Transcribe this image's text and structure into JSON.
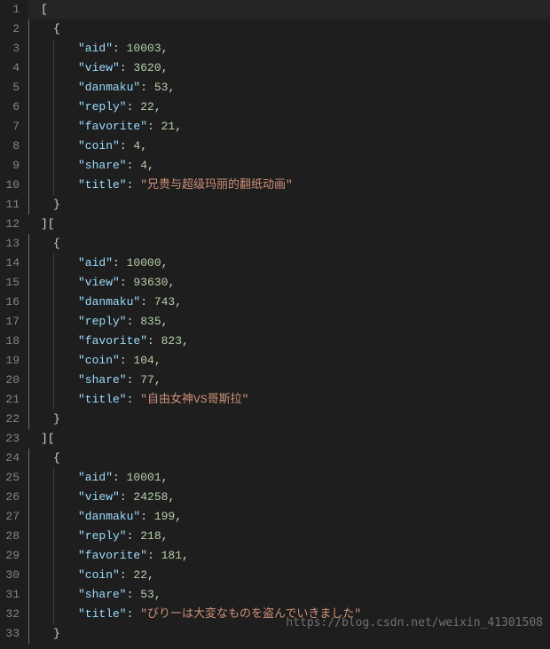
{
  "lines": [
    {
      "n": 1,
      "ind": 0,
      "tokens": [
        {
          "t": "bracket",
          "v": "["
        }
      ],
      "hl": true
    },
    {
      "n": 2,
      "ind": 1,
      "tokens": [
        {
          "t": "bracket",
          "v": "{"
        }
      ]
    },
    {
      "n": 3,
      "ind": 2,
      "tokens": [
        {
          "t": "key",
          "v": "\"aid\""
        },
        {
          "t": "colon",
          "v": ": "
        },
        {
          "t": "num",
          "v": "10003"
        },
        {
          "t": "comma",
          "v": ","
        }
      ]
    },
    {
      "n": 4,
      "ind": 2,
      "tokens": [
        {
          "t": "key",
          "v": "\"view\""
        },
        {
          "t": "colon",
          "v": ": "
        },
        {
          "t": "num",
          "v": "3620"
        },
        {
          "t": "comma",
          "v": ","
        }
      ]
    },
    {
      "n": 5,
      "ind": 2,
      "tokens": [
        {
          "t": "key",
          "v": "\"danmaku\""
        },
        {
          "t": "colon",
          "v": ": "
        },
        {
          "t": "num",
          "v": "53"
        },
        {
          "t": "comma",
          "v": ","
        }
      ]
    },
    {
      "n": 6,
      "ind": 2,
      "tokens": [
        {
          "t": "key",
          "v": "\"reply\""
        },
        {
          "t": "colon",
          "v": ": "
        },
        {
          "t": "num",
          "v": "22"
        },
        {
          "t": "comma",
          "v": ","
        }
      ]
    },
    {
      "n": 7,
      "ind": 2,
      "tokens": [
        {
          "t": "key",
          "v": "\"favorite\""
        },
        {
          "t": "colon",
          "v": ": "
        },
        {
          "t": "num",
          "v": "21"
        },
        {
          "t": "comma",
          "v": ","
        }
      ]
    },
    {
      "n": 8,
      "ind": 2,
      "tokens": [
        {
          "t": "key",
          "v": "\"coin\""
        },
        {
          "t": "colon",
          "v": ": "
        },
        {
          "t": "num",
          "v": "4"
        },
        {
          "t": "comma",
          "v": ","
        }
      ]
    },
    {
      "n": 9,
      "ind": 2,
      "tokens": [
        {
          "t": "key",
          "v": "\"share\""
        },
        {
          "t": "colon",
          "v": ": "
        },
        {
          "t": "num",
          "v": "4"
        },
        {
          "t": "comma",
          "v": ","
        }
      ]
    },
    {
      "n": 10,
      "ind": 2,
      "tokens": [
        {
          "t": "key",
          "v": "\"title\""
        },
        {
          "t": "colon",
          "v": ": "
        },
        {
          "t": "str",
          "v": "\"兄贵与超级玛丽的翻纸动画\""
        }
      ]
    },
    {
      "n": 11,
      "ind": 1,
      "tokens": [
        {
          "t": "bracket",
          "v": "}"
        }
      ]
    },
    {
      "n": 12,
      "ind": 0,
      "tokens": [
        {
          "t": "bracket",
          "v": "]["
        }
      ]
    },
    {
      "n": 13,
      "ind": 1,
      "tokens": [
        {
          "t": "bracket",
          "v": "{"
        }
      ]
    },
    {
      "n": 14,
      "ind": 2,
      "tokens": [
        {
          "t": "key",
          "v": "\"aid\""
        },
        {
          "t": "colon",
          "v": ": "
        },
        {
          "t": "num",
          "v": "10000"
        },
        {
          "t": "comma",
          "v": ","
        }
      ]
    },
    {
      "n": 15,
      "ind": 2,
      "tokens": [
        {
          "t": "key",
          "v": "\"view\""
        },
        {
          "t": "colon",
          "v": ": "
        },
        {
          "t": "num",
          "v": "93630"
        },
        {
          "t": "comma",
          "v": ","
        }
      ]
    },
    {
      "n": 16,
      "ind": 2,
      "tokens": [
        {
          "t": "key",
          "v": "\"danmaku\""
        },
        {
          "t": "colon",
          "v": ": "
        },
        {
          "t": "num",
          "v": "743"
        },
        {
          "t": "comma",
          "v": ","
        }
      ]
    },
    {
      "n": 17,
      "ind": 2,
      "tokens": [
        {
          "t": "key",
          "v": "\"reply\""
        },
        {
          "t": "colon",
          "v": ": "
        },
        {
          "t": "num",
          "v": "835"
        },
        {
          "t": "comma",
          "v": ","
        }
      ]
    },
    {
      "n": 18,
      "ind": 2,
      "tokens": [
        {
          "t": "key",
          "v": "\"favorite\""
        },
        {
          "t": "colon",
          "v": ": "
        },
        {
          "t": "num",
          "v": "823"
        },
        {
          "t": "comma",
          "v": ","
        }
      ]
    },
    {
      "n": 19,
      "ind": 2,
      "tokens": [
        {
          "t": "key",
          "v": "\"coin\""
        },
        {
          "t": "colon",
          "v": ": "
        },
        {
          "t": "num",
          "v": "104"
        },
        {
          "t": "comma",
          "v": ","
        }
      ]
    },
    {
      "n": 20,
      "ind": 2,
      "tokens": [
        {
          "t": "key",
          "v": "\"share\""
        },
        {
          "t": "colon",
          "v": ": "
        },
        {
          "t": "num",
          "v": "77"
        },
        {
          "t": "comma",
          "v": ","
        }
      ]
    },
    {
      "n": 21,
      "ind": 2,
      "tokens": [
        {
          "t": "key",
          "v": "\"title\""
        },
        {
          "t": "colon",
          "v": ": "
        },
        {
          "t": "str",
          "v": "\"自由女神VS哥斯拉\""
        }
      ]
    },
    {
      "n": 22,
      "ind": 1,
      "tokens": [
        {
          "t": "bracket",
          "v": "}"
        }
      ]
    },
    {
      "n": 23,
      "ind": 0,
      "tokens": [
        {
          "t": "bracket",
          "v": "]["
        }
      ]
    },
    {
      "n": 24,
      "ind": 1,
      "tokens": [
        {
          "t": "bracket",
          "v": "{"
        }
      ]
    },
    {
      "n": 25,
      "ind": 2,
      "tokens": [
        {
          "t": "key",
          "v": "\"aid\""
        },
        {
          "t": "colon",
          "v": ": "
        },
        {
          "t": "num",
          "v": "10001"
        },
        {
          "t": "comma",
          "v": ","
        }
      ]
    },
    {
      "n": 26,
      "ind": 2,
      "tokens": [
        {
          "t": "key",
          "v": "\"view\""
        },
        {
          "t": "colon",
          "v": ": "
        },
        {
          "t": "num",
          "v": "24258"
        },
        {
          "t": "comma",
          "v": ","
        }
      ]
    },
    {
      "n": 27,
      "ind": 2,
      "tokens": [
        {
          "t": "key",
          "v": "\"danmaku\""
        },
        {
          "t": "colon",
          "v": ": "
        },
        {
          "t": "num",
          "v": "199"
        },
        {
          "t": "comma",
          "v": ","
        }
      ]
    },
    {
      "n": 28,
      "ind": 2,
      "tokens": [
        {
          "t": "key",
          "v": "\"reply\""
        },
        {
          "t": "colon",
          "v": ": "
        },
        {
          "t": "num",
          "v": "218"
        },
        {
          "t": "comma",
          "v": ","
        }
      ]
    },
    {
      "n": 29,
      "ind": 2,
      "tokens": [
        {
          "t": "key",
          "v": "\"favorite\""
        },
        {
          "t": "colon",
          "v": ": "
        },
        {
          "t": "num",
          "v": "181"
        },
        {
          "t": "comma",
          "v": ","
        }
      ]
    },
    {
      "n": 30,
      "ind": 2,
      "tokens": [
        {
          "t": "key",
          "v": "\"coin\""
        },
        {
          "t": "colon",
          "v": ": "
        },
        {
          "t": "num",
          "v": "22"
        },
        {
          "t": "comma",
          "v": ","
        }
      ]
    },
    {
      "n": 31,
      "ind": 2,
      "tokens": [
        {
          "t": "key",
          "v": "\"share\""
        },
        {
          "t": "colon",
          "v": ": "
        },
        {
          "t": "num",
          "v": "53"
        },
        {
          "t": "comma",
          "v": ","
        }
      ]
    },
    {
      "n": 32,
      "ind": 2,
      "tokens": [
        {
          "t": "key",
          "v": "\"title\""
        },
        {
          "t": "colon",
          "v": ": "
        },
        {
          "t": "str",
          "v": "\"びりーは大変なものを盗んでいきました\""
        }
      ]
    },
    {
      "n": 33,
      "ind": 1,
      "tokens": [
        {
          "t": "bracket",
          "v": "}"
        }
      ]
    }
  ],
  "watermark": "https://blog.csdn.net/weixin_41301508",
  "indent_width": 28
}
